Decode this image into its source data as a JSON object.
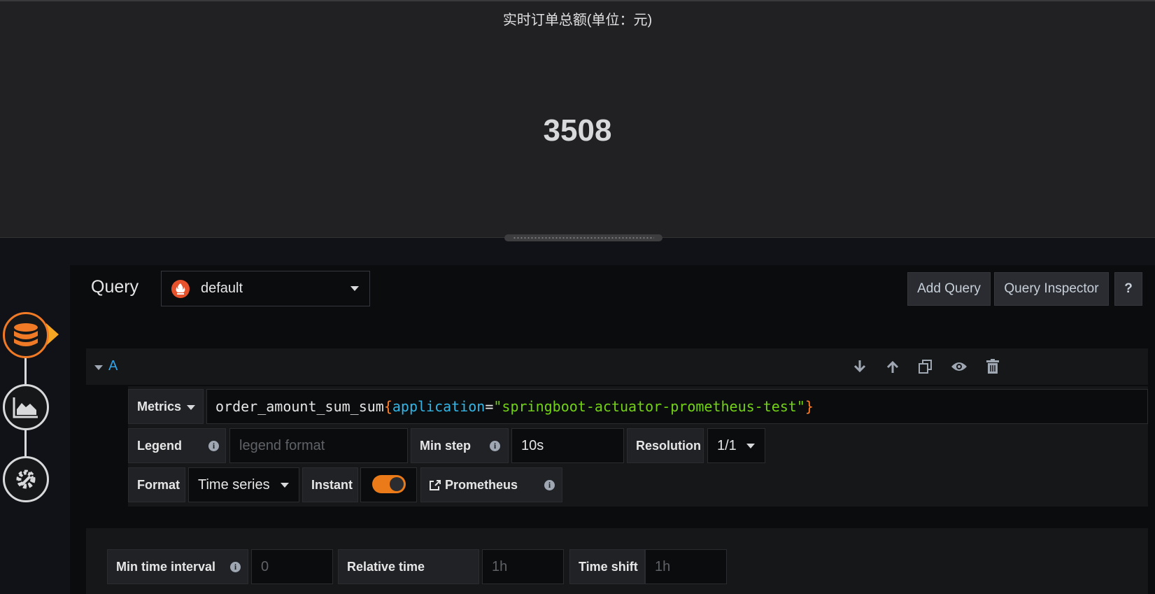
{
  "panel": {
    "title": "实时订单总额(单位：元)",
    "value": "3508"
  },
  "editor": {
    "section_label": "Query",
    "datasource": "default",
    "add_query_label": "Add Query",
    "query_inspector_label": "Query Inspector",
    "help_label": "?"
  },
  "query": {
    "ref_id": "A",
    "metrics_label": "Metrics",
    "expr": {
      "metric": "order_amount_sum_sum",
      "open_brace": "{",
      "label_key": "application",
      "equals": "=",
      "label_value": "\"springboot-actuator-prometheus-test\"",
      "close_brace": "}"
    },
    "legend_label": "Legend",
    "legend_placeholder": "legend format",
    "min_step_label": "Min step",
    "min_step_value": "10s",
    "resolution_label": "Resolution",
    "resolution_value": "1/1",
    "format_label": "Format",
    "format_value": "Time series",
    "instant_label": "Instant",
    "instant_enabled": true,
    "prometheus_link_label": "Prometheus"
  },
  "options": {
    "min_interval_label": "Min time interval",
    "min_interval_placeholder": "0",
    "relative_time_label": "Relative time",
    "relative_time_placeholder": "1h",
    "time_shift_label": "Time shift",
    "time_shift_placeholder": "1h"
  },
  "colors": {
    "accent": "#f07a26",
    "ref_id": "#33a2e5",
    "toggle_on": "#eb7b18"
  }
}
